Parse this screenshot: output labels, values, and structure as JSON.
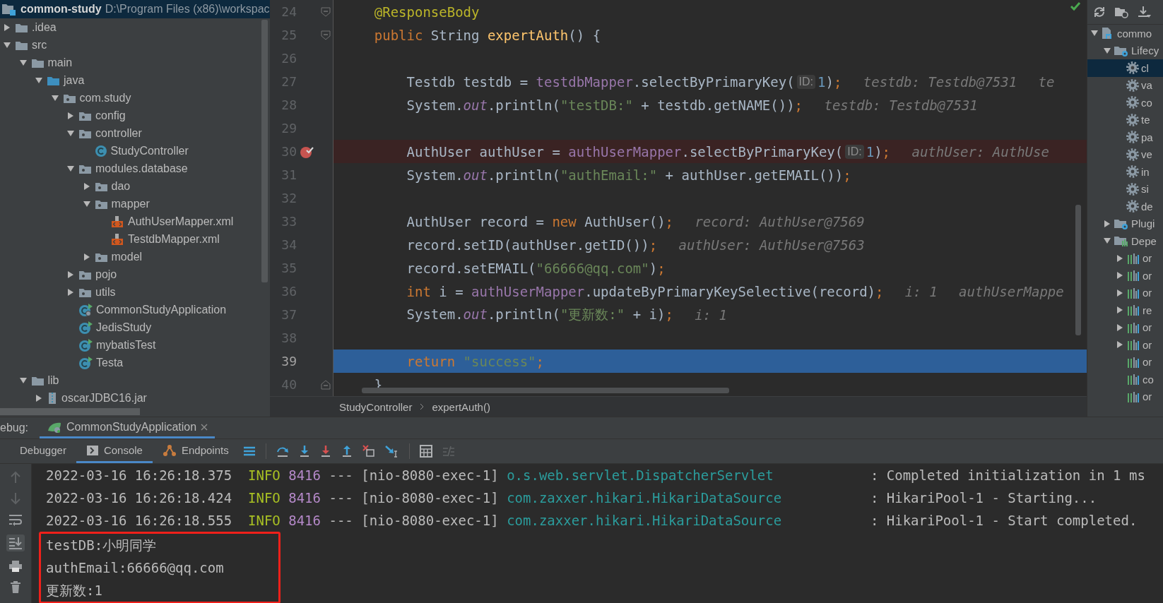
{
  "project": {
    "title": "common-study",
    "path": "D:\\Program Files (x86)\\workspac",
    "items": [
      {
        "label": ".idea",
        "kind": "folder",
        "expanded": false
      },
      {
        "label": "src",
        "kind": "folder",
        "expanded": true,
        "children": [
          {
            "label": "main",
            "kind": "folder",
            "expanded": true,
            "children": [
              {
                "label": "java",
                "kind": "source",
                "expanded": true,
                "children": [
                  {
                    "label": "com.study",
                    "kind": "package",
                    "expanded": true,
                    "children": [
                      {
                        "label": "config",
                        "kind": "package",
                        "expanded": false
                      },
                      {
                        "label": "controller",
                        "kind": "package",
                        "expanded": true,
                        "children": [
                          {
                            "label": "StudyController",
                            "kind": "class"
                          }
                        ]
                      },
                      {
                        "label": "modules.database",
                        "kind": "package",
                        "expanded": true,
                        "children": [
                          {
                            "label": "dao",
                            "kind": "package",
                            "expanded": false
                          },
                          {
                            "label": "mapper",
                            "kind": "package",
                            "expanded": true,
                            "children": [
                              {
                                "label": "AuthUserMapper.xml",
                                "kind": "xml"
                              },
                              {
                                "label": "TestdbMapper.xml",
                                "kind": "xml"
                              }
                            ]
                          },
                          {
                            "label": "model",
                            "kind": "package",
                            "expanded": false
                          }
                        ]
                      },
                      {
                        "label": "pojo",
                        "kind": "package",
                        "expanded": false
                      },
                      {
                        "label": "utils",
                        "kind": "package",
                        "expanded": false
                      },
                      {
                        "label": "CommonStudyApplication",
                        "kind": "app"
                      },
                      {
                        "label": "JedisStudy",
                        "kind": "runnable"
                      },
                      {
                        "label": "mybatisTest",
                        "kind": "runnable"
                      },
                      {
                        "label": "Testa",
                        "kind": "runnable"
                      }
                    ]
                  }
                ]
              }
            ]
          },
          {
            "label": "lib",
            "kind": "folder",
            "expanded": true,
            "children": [
              {
                "label": "oscarJDBC16.jar",
                "kind": "jar",
                "expanded": false
              }
            ]
          }
        ]
      }
    ]
  },
  "editor": {
    "lines": [
      {
        "number": "24",
        "fold_start": true,
        "code": [
          {
            "kind": "annotation",
            "text": "    @ResponseBody"
          }
        ]
      },
      {
        "number": "25",
        "fold_start": true,
        "code": [
          {
            "kind": "keyword",
            "text": "    public "
          },
          {
            "kind": "plain",
            "text": "String "
          },
          {
            "kind": "method",
            "text": "expertAuth"
          },
          {
            "kind": "plain",
            "text": "() {"
          }
        ]
      },
      {
        "number": "26"
      },
      {
        "number": "27",
        "code": [
          {
            "kind": "plain",
            "text": "        Testdb testdb = "
          },
          {
            "kind": "field",
            "text": "testdbMapper"
          },
          {
            "kind": "plain",
            "text": ".selectByPrimaryKey("
          },
          {
            "kind": "param",
            "text": "ID:"
          },
          {
            "kind": "number",
            "text": "1"
          },
          {
            "kind": "plain",
            "text": ")"
          },
          {
            "kind": "keyword",
            "text": ";"
          }
        ],
        "hints": [
          "testdb: Testdb@7531",
          "te"
        ]
      },
      {
        "number": "28",
        "code": [
          {
            "kind": "plain",
            "text": "        System."
          },
          {
            "kind": "static",
            "text": "out"
          },
          {
            "kind": "plain",
            "text": ".println("
          },
          {
            "kind": "string",
            "text": "\"testDB:\""
          },
          {
            "kind": "plain",
            "text": " + testdb.getNAME())"
          },
          {
            "kind": "keyword",
            "text": ";"
          }
        ],
        "hints": [
          "testdb: Testdb@7531"
        ]
      },
      {
        "number": "29"
      },
      {
        "number": "30",
        "breakpoint": true,
        "code": [
          {
            "kind": "plain",
            "text": "        AuthUser authUser = "
          },
          {
            "kind": "field",
            "text": "authUserMapper"
          },
          {
            "kind": "plain",
            "text": ".selectByPrimaryKey("
          },
          {
            "kind": "param",
            "text": "ID:"
          },
          {
            "kind": "number",
            "text": "1"
          },
          {
            "kind": "plain",
            "text": ")"
          },
          {
            "kind": "keyword",
            "text": ";"
          }
        ],
        "hints": [
          "authUser: AuthUse"
        ]
      },
      {
        "number": "31",
        "code": [
          {
            "kind": "plain",
            "text": "        System."
          },
          {
            "kind": "static",
            "text": "out"
          },
          {
            "kind": "plain",
            "text": ".println("
          },
          {
            "kind": "string",
            "text": "\"authEmail:\""
          },
          {
            "kind": "plain",
            "text": " + authUser.getEMAIL())"
          },
          {
            "kind": "keyword",
            "text": ";"
          }
        ]
      },
      {
        "number": "32"
      },
      {
        "number": "33",
        "code": [
          {
            "kind": "plain",
            "text": "        AuthUser record = "
          },
          {
            "kind": "keyword",
            "text": "new "
          },
          {
            "kind": "plain",
            "text": "AuthUser()"
          },
          {
            "kind": "keyword",
            "text": ";"
          }
        ],
        "hints": [
          "record: AuthUser@7569"
        ]
      },
      {
        "number": "34",
        "code": [
          {
            "kind": "plain",
            "text": "        record.setID(authUser.getID())"
          },
          {
            "kind": "keyword",
            "text": ";"
          }
        ],
        "hints": [
          "authUser: AuthUser@7563"
        ]
      },
      {
        "number": "35",
        "code": [
          {
            "kind": "plain",
            "text": "        record.setEMAIL("
          },
          {
            "kind": "string",
            "text": "\"66666@qq.com\""
          },
          {
            "kind": "plain",
            "text": ")"
          },
          {
            "kind": "keyword",
            "text": ";"
          }
        ]
      },
      {
        "number": "36",
        "code": [
          {
            "kind": "keyword",
            "text": "        int "
          },
          {
            "kind": "plain",
            "text": "i = "
          },
          {
            "kind": "field",
            "text": "authUserMapper"
          },
          {
            "kind": "plain",
            "text": ".updateByPrimaryKeySelective(record)"
          },
          {
            "kind": "keyword",
            "text": ";"
          }
        ],
        "hints": [
          "i: 1",
          "authUserMappe"
        ]
      },
      {
        "number": "37",
        "code": [
          {
            "kind": "plain",
            "text": "        System."
          },
          {
            "kind": "static",
            "text": "out"
          },
          {
            "kind": "plain",
            "text": ".println("
          },
          {
            "kind": "string",
            "text": "\"更新数:\""
          },
          {
            "kind": "plain",
            "text": " + i)"
          },
          {
            "kind": "keyword",
            "text": ";"
          }
        ],
        "hints": [
          "i: 1"
        ]
      },
      {
        "number": "38"
      },
      {
        "number": "39",
        "current": true,
        "code": [
          {
            "kind": "keyword",
            "text": "        return "
          },
          {
            "kind": "string",
            "text": "\"success\""
          },
          {
            "kind": "keyword",
            "text": ";"
          }
        ]
      },
      {
        "number": "40",
        "fold_end": true,
        "code": [
          {
            "kind": "plain",
            "text": "    }"
          }
        ]
      }
    ],
    "breadcrumbs": [
      "StudyController",
      "expertAuth()"
    ]
  },
  "maven": {
    "items": [
      {
        "label": "commo",
        "kind": "project",
        "expanded": true,
        "children": [
          {
            "label": "Lifecy",
            "kind": "lifecycle",
            "expanded": true,
            "goals": [
              {
                "label": "cl",
                "selected": true
              },
              {
                "label": "va",
                "selected": false
              },
              {
                "label": "co",
                "selected": false
              },
              {
                "label": "te",
                "selected": false
              },
              {
                "label": "pa",
                "selected": false
              },
              {
                "label": "ve",
                "selected": false
              },
              {
                "label": "in",
                "selected": false
              },
              {
                "label": "si",
                "selected": false
              },
              {
                "label": "de",
                "selected": false
              }
            ]
          },
          {
            "label": "Plugi",
            "kind": "plugins",
            "expanded": false
          },
          {
            "label": "Depe",
            "kind": "dependencies",
            "expanded": true,
            "children": [
              {
                "label": "or",
                "kind": "library",
                "expanded": false
              },
              {
                "label": "or",
                "kind": "library",
                "expanded": false
              },
              {
                "label": "or",
                "kind": "library",
                "expanded": false
              },
              {
                "label": "re",
                "kind": "library",
                "expanded": false
              },
              {
                "label": "or",
                "kind": "library",
                "expanded": false
              },
              {
                "label": "or",
                "kind": "library",
                "expanded": false
              },
              {
                "label": "or",
                "kind": "library"
              },
              {
                "label": "co",
                "kind": "library"
              },
              {
                "label": "or",
                "kind": "library"
              }
            ]
          }
        ]
      }
    ]
  },
  "debug": {
    "label": "ebug:",
    "session_tabs": [
      {
        "label": "CommonStudyApplication",
        "selected": true
      }
    ],
    "tabs": [
      {
        "label": "Debugger",
        "kind": "debugger",
        "selected": false
      },
      {
        "label": "Console",
        "kind": "console",
        "selected": true
      },
      {
        "label": "Endpoints",
        "kind": "endpoints",
        "selected": false
      }
    ],
    "console": {
      "log_lines": [
        {
          "time": "2022-03-16 16:26:18.375",
          "level": "INFO",
          "pid": "8416",
          "separator": "---",
          "thread": "[nio-8080-exec-1]",
          "logger": "o.s.web.servlet.DispatcherServlet",
          "message": ": Completed initialization in 1 ms"
        },
        {
          "time": "2022-03-16 16:26:18.424",
          "level": "INFO",
          "pid": "8416",
          "separator": "---",
          "thread": "[nio-8080-exec-1]",
          "logger": "com.zaxxer.hikari.HikariDataSource",
          "message": ": HikariPool-1 - Starting..."
        },
        {
          "time": "2022-03-16 16:26:18.555",
          "level": "INFO",
          "pid": "8416",
          "separator": "---",
          "thread": "[nio-8080-exec-1]",
          "logger": "com.zaxxer.hikari.HikariDataSource",
          "message": ": HikariPool-1 - Start completed."
        }
      ],
      "output_lines": [
        "testDB:小明同学",
        "authEmail:66666@qq.com",
        "更新数:1"
      ],
      "output_marked": true
    }
  }
}
